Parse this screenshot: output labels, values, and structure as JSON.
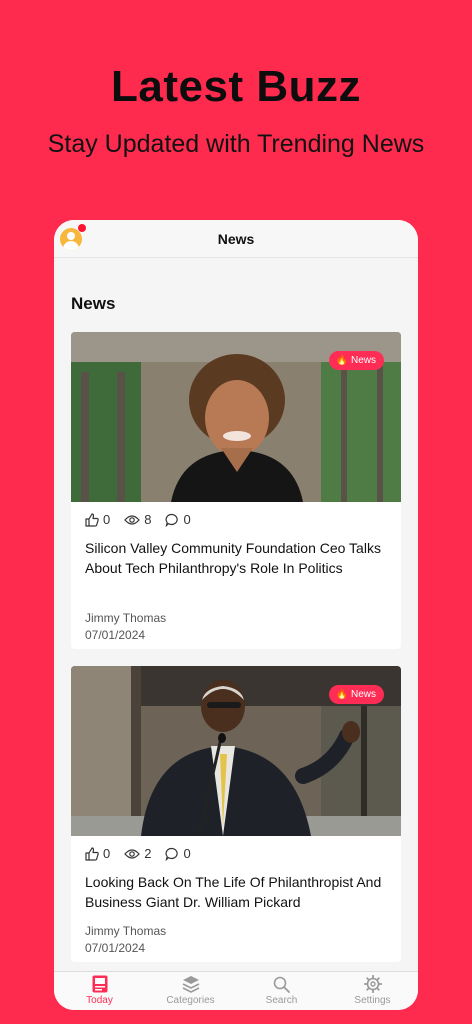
{
  "promo": {
    "title": "Latest Buzz",
    "subtitle": "Stay Updated with Trending News"
  },
  "app": {
    "header_title": "News",
    "section_title": "News",
    "accent_color": "#ff2d55"
  },
  "articles": [
    {
      "badge": "News",
      "likes": "0",
      "views": "8",
      "comments": "0",
      "title": "Silicon Valley Community Foundation Ceo Talks About Tech Philanthropy's Role In Politics",
      "author": "Jimmy Thomas",
      "date": "07/01/2024"
    },
    {
      "badge": "News",
      "likes": "0",
      "views": "2",
      "comments": "0",
      "title": "Looking Back On The Life Of Philanthropist And Business Giant Dr. William Pickard",
      "author": "Jimmy Thomas",
      "date": "07/01/2024"
    }
  ],
  "tabs": [
    {
      "label": "Today",
      "icon": "today-icon",
      "active": true
    },
    {
      "label": "Categories",
      "icon": "layers-icon",
      "active": false
    },
    {
      "label": "Search",
      "icon": "search-icon",
      "active": false
    },
    {
      "label": "Settings",
      "icon": "gear-icon",
      "active": false
    }
  ]
}
